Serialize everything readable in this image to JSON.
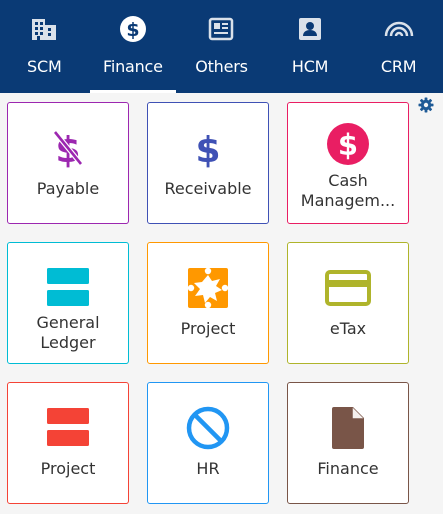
{
  "nav": {
    "tabs": [
      {
        "label": "SCM",
        "icon": "building-icon"
      },
      {
        "label": "Finance",
        "icon": "dollar-circle-icon",
        "active": true
      },
      {
        "label": "Others",
        "icon": "newspaper-icon"
      },
      {
        "label": "HCM",
        "icon": "id-badge-icon"
      },
      {
        "label": "CRM",
        "icon": "signal-arcs-icon"
      }
    ]
  },
  "settings_icon": "gear-icon",
  "tiles": [
    {
      "label": "Payable",
      "icon": "dollar-strikethrough-icon",
      "border": "#9c27b0",
      "color": "#9c27b0"
    },
    {
      "label": "Receivable",
      "icon": "dollar-icon",
      "border": "#3f51b5",
      "color": "#3f51b5"
    },
    {
      "label": "Cash Managem...",
      "label_line1": "Cash",
      "label_line2": "Managem...",
      "icon": "dollar-circle-icon",
      "border": "#e91e63",
      "color": "#e91e63"
    },
    {
      "label": "General Ledger",
      "label_line1": "General",
      "label_line2": "Ledger",
      "icon": "two-bars-icon",
      "border": "#00bcd4",
      "color": "#00bcd4"
    },
    {
      "label": "Project",
      "icon": "puzzle-piece-icon",
      "border": "#ff9800",
      "color": "#ff9800"
    },
    {
      "label": "eTax",
      "icon": "credit-card-icon",
      "border": "#afb42b",
      "color": "#afb42b"
    },
    {
      "label": "Project",
      "icon": "two-bars-icon",
      "border": "#f44336",
      "color": "#f44336"
    },
    {
      "label": "HR",
      "icon": "prohibited-icon",
      "border": "#2196f3",
      "color": "#2196f3"
    },
    {
      "label": "Finance",
      "icon": "document-icon",
      "border": "#795548",
      "color": "#795548"
    }
  ],
  "colors": {
    "nav_bg": "#0a3a75",
    "settings": "#1e5a96"
  }
}
